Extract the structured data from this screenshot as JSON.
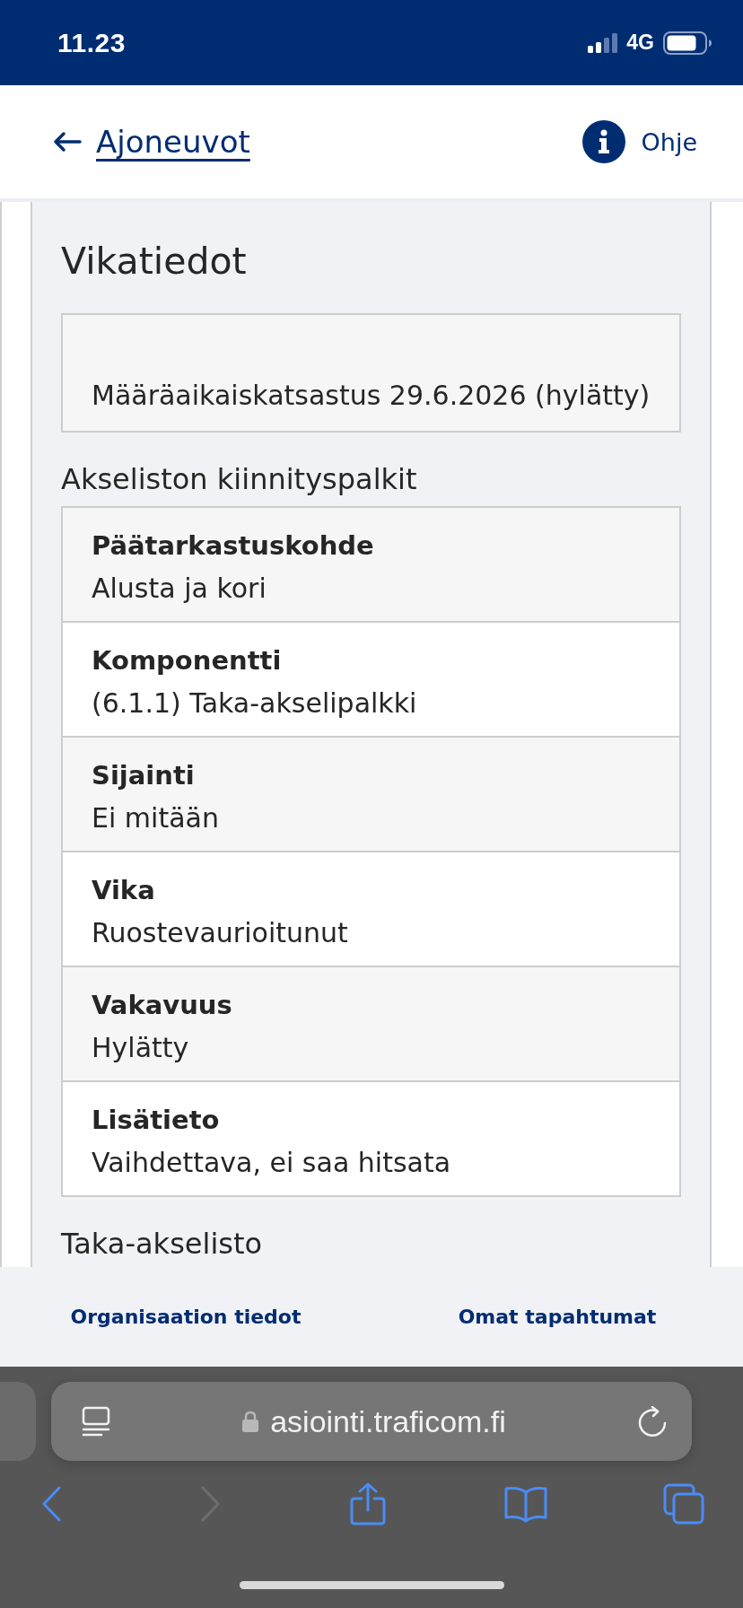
{
  "status_bar": {
    "time": "11.23",
    "network": "4G"
  },
  "header": {
    "back_link": "Ajoneuvot",
    "help_link": "Ohje"
  },
  "fault_details": {
    "title": "Vikatiedot",
    "inspection": "Määräaikaiskatsastus 29.6.2026 (hylätty)",
    "groups": [
      {
        "title": "Akseliston kiinnityspalkit",
        "rows": [
          {
            "label": "Päätarkastuskohde",
            "value": "Alusta ja kori"
          },
          {
            "label": "Komponentti",
            "value": "(6.1.1) Taka-akselipalkki"
          },
          {
            "label": "Sijainti",
            "value": "Ei mitään"
          },
          {
            "label": "Vika",
            "value": "Ruostevaurioitunut"
          },
          {
            "label": "Vakavuus",
            "value": "Hylätty"
          },
          {
            "label": "Lisätieto",
            "value": "Vaihdettava, ei saa hitsata"
          }
        ]
      },
      {
        "title": "Taka-akselisto"
      }
    ]
  },
  "footer_links": [
    "Organisaation tiedot",
    "Omat tapahtumat"
  ],
  "browser": {
    "url": "asiointi.traficom.fi",
    "toolbar": [
      {
        "kind": "back",
        "disabled": false
      },
      {
        "kind": "forward",
        "disabled": true
      },
      {
        "kind": "share",
        "disabled": false
      },
      {
        "kind": "bookmarks",
        "disabled": false
      },
      {
        "kind": "tabs",
        "disabled": false
      }
    ]
  }
}
